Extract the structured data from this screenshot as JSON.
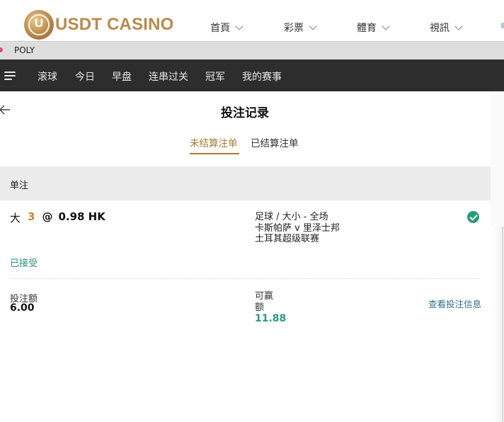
{
  "site": {
    "logo_mark": "U",
    "logo_text": "USDT CASINO",
    "nav": [
      {
        "label": "首頁"
      },
      {
        "label": "彩票"
      },
      {
        "label": "體育"
      },
      {
        "label": "視訊"
      }
    ]
  },
  "tab": {
    "label": "POLY",
    "dot_color": "#e0498a"
  },
  "sports_nav": {
    "items": [
      "滚球",
      "今日",
      "早盘",
      "连串过关",
      "冠军",
      "我的赛事"
    ]
  },
  "page": {
    "title": "投注记录",
    "subtabs": [
      {
        "label": "未结算注单",
        "active": true
      },
      {
        "label": "已结算注单",
        "active": false
      }
    ]
  },
  "section": {
    "label": "单注"
  },
  "bet": {
    "pick": "大",
    "line": "3",
    "at": "@",
    "odds": "0.98 HK",
    "market": "足球 / 大小 - 全场",
    "match": "卡斯帕萨 v 里泽士邦",
    "league": "土耳其超级联赛",
    "status": "已接受",
    "stake_label": "投注额",
    "stake": "6.00",
    "win_label": "可赢额",
    "win": "11.88",
    "details_link": "查看投注信息"
  },
  "colors": {
    "accent_gold": "#a97a2c",
    "success_green": "#2a9a78",
    "nav_dark": "#2d2d2d",
    "link_blue": "#2d6f8f"
  }
}
